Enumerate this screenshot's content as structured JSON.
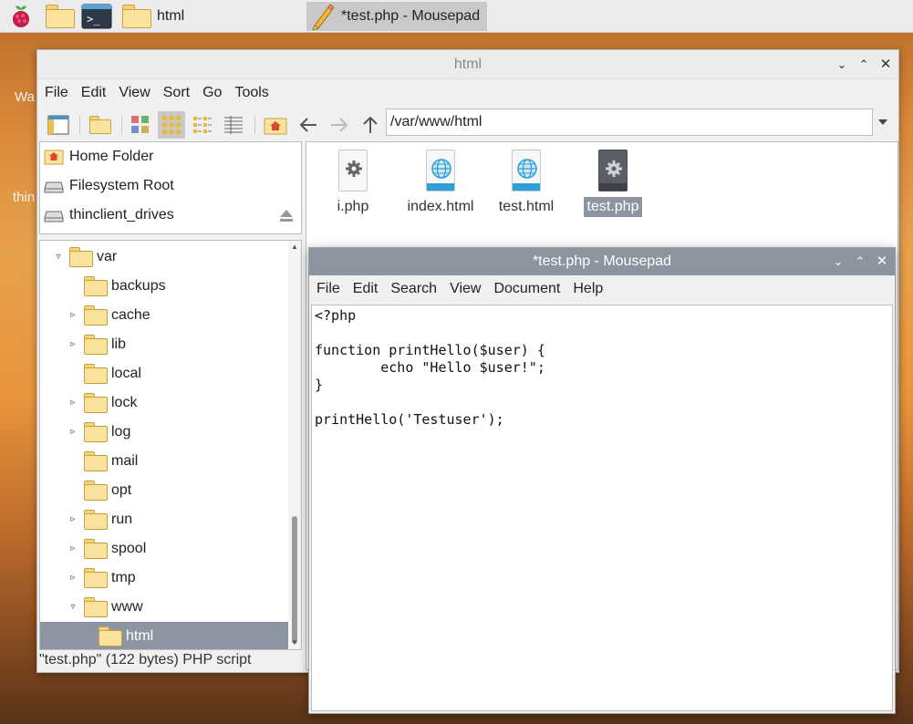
{
  "desktop": {
    "text_1": "Wa",
    "text_2": "thin"
  },
  "taskbar": {
    "items": [
      {
        "label": "html"
      },
      {
        "label": "*test.php - Mousepad"
      }
    ]
  },
  "file_manager": {
    "title": "html",
    "menu": [
      "File",
      "Edit",
      "View",
      "Sort",
      "Go",
      "Tools"
    ],
    "path": "/var/www/html",
    "places": [
      {
        "label": "Home Folder"
      },
      {
        "label": "Filesystem Root"
      },
      {
        "label": "thinclient_drives"
      }
    ],
    "tree": [
      {
        "label": "var"
      },
      {
        "label": "backups"
      },
      {
        "label": "cache"
      },
      {
        "label": "lib"
      },
      {
        "label": "local"
      },
      {
        "label": "lock"
      },
      {
        "label": "log"
      },
      {
        "label": "mail"
      },
      {
        "label": "opt"
      },
      {
        "label": "run"
      },
      {
        "label": "spool"
      },
      {
        "label": "tmp"
      },
      {
        "label": "www"
      },
      {
        "label": "html"
      }
    ],
    "files": [
      {
        "name": "i.php",
        "icon": "php-gear-icon"
      },
      {
        "name": "index.html",
        "icon": "html-globe-icon"
      },
      {
        "name": "test.html",
        "icon": "html-globe-icon"
      },
      {
        "name": "test.php",
        "icon": "php-gear-icon"
      }
    ],
    "status": "\"test.php\" (122 bytes) PHP script"
  },
  "mousepad": {
    "title": "*test.php - Mousepad",
    "menu": [
      "File",
      "Edit",
      "Search",
      "View",
      "Document",
      "Help"
    ],
    "code": "<?php\n\nfunction printHello($user) {\n        echo \"Hello $user!\";\n}\n\nprintHello('Testuser');"
  },
  "colors": {
    "selection": "#8c959f",
    "accent_blue": "#2f9fd6"
  }
}
